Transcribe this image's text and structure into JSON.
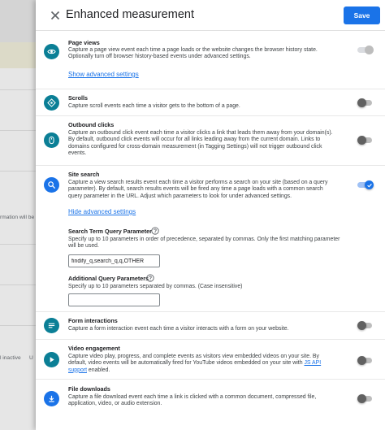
{
  "background": {
    "text_1": "rmation will be",
    "text_2": "l inactive",
    "text_3": "U"
  },
  "header": {
    "title": "Enhanced measurement",
    "save_label": "Save"
  },
  "sections": {
    "page_views": {
      "title": "Page views",
      "description": "Capture a page view event each time a page loads or the website changes the browser history state. Optionally turn off browser history-based events under advanced settings.",
      "link": "Show advanced settings",
      "enabled": true,
      "icon": "eye-icon"
    },
    "scrolls": {
      "title": "Scrolls",
      "description": "Capture scroll events each time a visitor gets to the bottom of a page.",
      "enabled": false,
      "icon": "crosshair-icon"
    },
    "outbound_clicks": {
      "title": "Outbound clicks",
      "description": "Capture an outbound click event each time a visitor clicks a link that leads them away from your domain(s). By default, outbound click events will occur for all links leading away from the current domain. Links to domains configured for cross-domain measurement (in Tagging Settings) will not trigger outbound click events.",
      "enabled": false,
      "icon": "mouse-icon"
    },
    "site_search": {
      "title": "Site search",
      "description": "Capture a view search results event each time a visitor performs a search on your site (based on a query parameter). By default, search results events will be fired any time a page loads with a common search query parameter in the URL. Adjust which parameters to look for under advanced settings.",
      "link": "Hide advanced settings",
      "enabled": true,
      "icon": "search-icon",
      "term_label": "Search Term Query Parameter",
      "term_desc": "Specify up to 10 parameters in order of precedence, separated by commas. Only the first matching parameter will be used.",
      "term_value": "findify_q,search_q,q,OTHER",
      "additional_label": "Additional Query Parameters",
      "additional_desc": "Specify up to 10 parameters separated by commas. (Case insensitive)",
      "additional_value": ""
    },
    "form_interactions": {
      "title": "Form interactions",
      "description": "Capture a form interaction event each time a visitor interacts with a form on your website.",
      "enabled": false,
      "icon": "form-icon"
    },
    "video_engagement": {
      "title": "Video engagement",
      "description_start": "Capture video play, progress, and complete events as visitors view embedded videos on your site. By default, video events will be automatically fired for YouTube videos embedded on your site with ",
      "description_link": "JS API support",
      "description_end": " enabled.",
      "enabled": false,
      "icon": "play-icon"
    },
    "file_downloads": {
      "title": "File downloads",
      "description": "Capture a file download event each time a link is clicked with a common document, compressed file, application, video, or audio extension.",
      "enabled": false,
      "icon": "download-icon"
    }
  },
  "colors": {
    "accent": "#1a73e8",
    "icon_teal": "#0b7f96"
  }
}
